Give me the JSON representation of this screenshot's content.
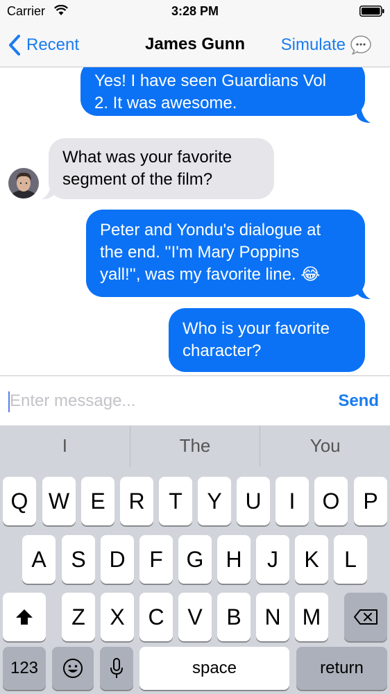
{
  "status_bar": {
    "carrier": "Carrier",
    "time": "3:28 PM"
  },
  "nav": {
    "back_label": "Recent",
    "title": "James Gunn",
    "simulate_label": "Simulate"
  },
  "messages": [
    {
      "direction": "outgoing",
      "text": "Yes! I have seen Guardians Vol\n2. It was awesome."
    },
    {
      "direction": "incoming",
      "text": "What was your favorite\nsegment of the film?"
    },
    {
      "direction": "outgoing",
      "text": "Peter and Yondu's dialogue at\nthe end. ''I'm Mary Poppins\nyall!'', was my favorite line. 😂"
    },
    {
      "direction": "outgoing",
      "text": "Who is your favorite\ncharacter?"
    }
  ],
  "input": {
    "placeholder": "Enter message...",
    "value": "",
    "send_label": "Send"
  },
  "keyboard": {
    "suggestions": [
      "I",
      "The",
      "You"
    ],
    "row1": [
      "Q",
      "W",
      "E",
      "R",
      "T",
      "Y",
      "U",
      "I",
      "O",
      "P"
    ],
    "row2": [
      "A",
      "S",
      "D",
      "F",
      "G",
      "H",
      "J",
      "K",
      "L"
    ],
    "row3": [
      "Z",
      "X",
      "C",
      "V",
      "B",
      "N",
      "M"
    ],
    "numbers_label": "123",
    "space_label": "space",
    "return_label": "return"
  },
  "colors": {
    "accent": "#1a7cf0",
    "outgoing_bubble": "#0b72f5",
    "incoming_bubble": "#e6e5ea",
    "keyboard_bg": "#d1d4da"
  }
}
